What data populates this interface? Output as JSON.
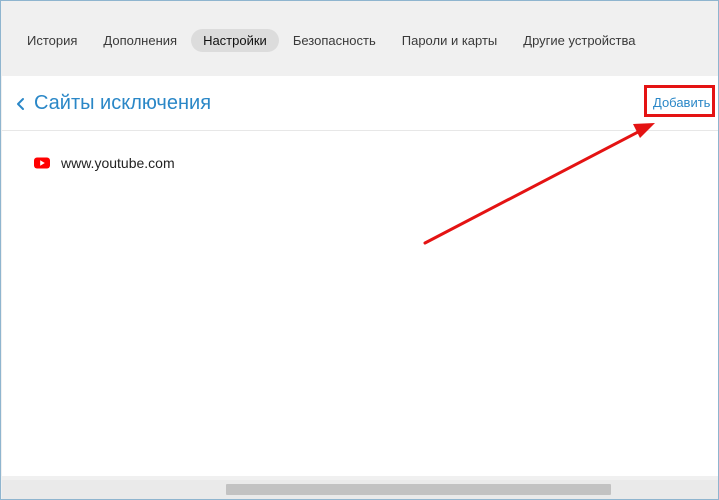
{
  "nav": {
    "tabs": [
      {
        "label": "История",
        "active": false
      },
      {
        "label": "Дополнения",
        "active": false
      },
      {
        "label": "Настройки",
        "active": true
      },
      {
        "label": "Безопасность",
        "active": false
      },
      {
        "label": "Пароли и карты",
        "active": false
      },
      {
        "label": "Другие устройства",
        "active": false
      }
    ]
  },
  "header": {
    "back_icon": "chevron-left-icon",
    "title": "Сайты исключения",
    "add_label": "Добавить"
  },
  "sites": [
    {
      "icon": "youtube-icon",
      "label": "www.youtube.com"
    }
  ],
  "colors": {
    "accent": "#2a87c7",
    "annotation": "#e41313",
    "youtube": "#ff0000"
  }
}
